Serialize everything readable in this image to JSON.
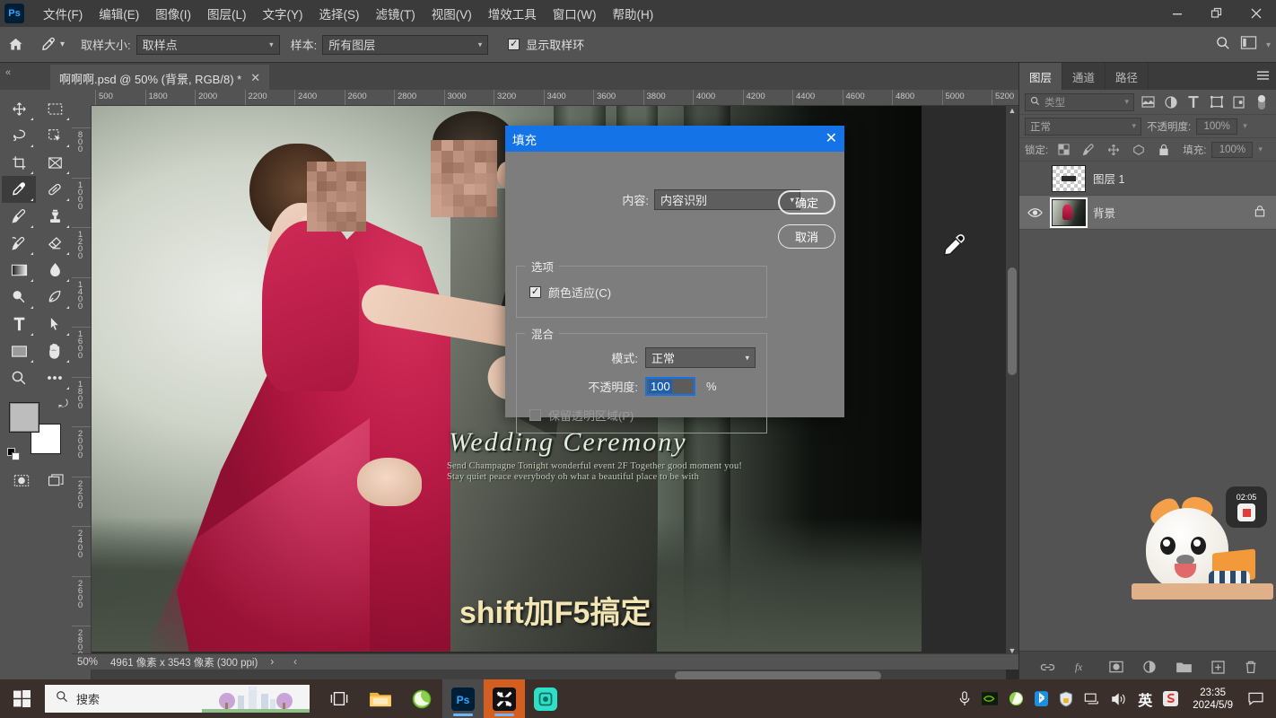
{
  "app": {
    "logo": "Ps",
    "menus": [
      {
        "label": "文件(F)"
      },
      {
        "label": "编辑(E)"
      },
      {
        "label": "图像(I)"
      },
      {
        "label": "图层(L)"
      },
      {
        "label": "文字(Y)"
      },
      {
        "label": "选择(S)"
      },
      {
        "label": "滤镜(T)"
      },
      {
        "label": "视图(V)"
      },
      {
        "label": "增效工具"
      },
      {
        "label": "窗口(W)"
      },
      {
        "label": "帮助(H)"
      }
    ],
    "window_controls": {
      "minimize": "—",
      "maximize": "❐",
      "close": "✕"
    }
  },
  "options_bar": {
    "home_icon": "home-icon",
    "tool_icon": "eyedropper-icon",
    "sample_size_label": "取样大小:",
    "sample_size_value": "取样点",
    "sample_label": "样本:",
    "sample_value": "所有图层",
    "show_ring_label": "显示取样环",
    "show_ring_checked": "✓",
    "search_icon": "search-icon",
    "workspace_icon": "workspace-icon"
  },
  "tab_bar": {
    "collapse": "«",
    "document_title": "啊啊啊.psd @ 50% (背景, RGB/8) *",
    "close": "✕",
    "expand": "»"
  },
  "toolbar": {
    "tools": [
      {
        "name": "move-tool",
        "selected": false
      },
      {
        "name": "marquee-tool",
        "selected": false
      },
      {
        "name": "lasso-tool",
        "selected": false
      },
      {
        "name": "quick-select-tool",
        "selected": false
      },
      {
        "name": "crop-tool",
        "selected": false
      },
      {
        "name": "frame-tool",
        "selected": false
      },
      {
        "name": "eyedropper-tool",
        "selected": true
      },
      {
        "name": "healing-brush-tool",
        "selected": false
      },
      {
        "name": "brush-tool",
        "selected": false
      },
      {
        "name": "clone-stamp-tool",
        "selected": false
      },
      {
        "name": "history-brush-tool",
        "selected": false
      },
      {
        "name": "eraser-tool",
        "selected": false
      },
      {
        "name": "gradient-tool",
        "selected": false
      },
      {
        "name": "blur-tool",
        "selected": false
      },
      {
        "name": "dodge-tool",
        "selected": false
      },
      {
        "name": "pen-tool",
        "selected": false
      },
      {
        "name": "type-tool",
        "selected": false
      },
      {
        "name": "path-selection-tool",
        "selected": false
      },
      {
        "name": "rectangle-tool",
        "selected": false
      },
      {
        "name": "hand-tool",
        "selected": false
      },
      {
        "name": "zoom-tool",
        "selected": false
      },
      {
        "name": "edit-toolbar-tool",
        "selected": false
      }
    ],
    "foreground_color": "#bdbdbd",
    "background_color": "#ffffff"
  },
  "canvas": {
    "ruler_h_ticks": [
      "500",
      "1800",
      "2000",
      "2200",
      "2400",
      "2600",
      "2800",
      "3000",
      "3200",
      "3400",
      "3600",
      "3800",
      "4000",
      "4200",
      "4400",
      "4600",
      "4800",
      "5000",
      "5200"
    ],
    "ruler_v_ticks": [
      "800",
      "1000",
      "1200",
      "1400",
      "1600",
      "1800",
      "2000",
      "2200",
      "2400",
      "2600",
      "2800"
    ],
    "artwork": {
      "title_text": "Wedding  Ceremony",
      "sub_text": "Send Champagne Tonight wonderful event 2F Together good moment you! Stay quiet peace everybody oh what a beautiful place to be with",
      "overlay_text": "shift加F5搞定",
      "cursor": "eyedropper-cursor"
    },
    "status": {
      "zoom": "50%",
      "dimensions": "4961 像素 x 3543 像素 (300 ppi)",
      "arrow": "›",
      "collapse": "‹"
    }
  },
  "right_panel": {
    "tabs": [
      {
        "label": "图层",
        "active": true
      },
      {
        "label": "通道",
        "active": false
      },
      {
        "label": "路径",
        "active": false
      }
    ],
    "menu_icon": "panel-menu-icon",
    "filter": {
      "search_icon": "search-icon",
      "type_label": "类型",
      "icons": [
        "image-filter-icon",
        "adjustment-filter-icon",
        "type-filter-icon",
        "shape-filter-icon",
        "smart-object-filter-icon"
      ],
      "toggle": "filter-toggle"
    },
    "blend": {
      "mode_label": "正常",
      "opacity_label": "不透明度:",
      "opacity_value": "100%"
    },
    "lock": {
      "label": "锁定:",
      "icons": [
        "lock-transparent-icon",
        "lock-image-icon",
        "lock-position-icon",
        "lock-artboard-icon",
        "lock-all-icon"
      ],
      "fill_label": "填充:",
      "fill_value": "100%"
    },
    "layers": [
      {
        "name": "图层 1",
        "visible": false,
        "locked": false,
        "selected": false,
        "thumb": "transparent"
      },
      {
        "name": "背景",
        "visible": true,
        "locked": true,
        "selected": true,
        "thumb": "photo"
      }
    ],
    "bottom_icons": [
      "link-layers-icon",
      "layer-style-fx-icon",
      "layer-mask-icon",
      "adjustment-layer-icon",
      "new-group-icon",
      "new-layer-icon",
      "delete-layer-icon"
    ]
  },
  "dialog": {
    "title": "填充",
    "close": "✕",
    "content_label": "内容:",
    "content_value": "内容识别",
    "ok_label": "确定",
    "cancel_label": "取消",
    "options_legend": "选项",
    "color_adapt_label": "颜色适应(C)",
    "color_adapt_checked": "✓",
    "blend_legend": "混合",
    "mode_label": "模式:",
    "mode_value": "正常",
    "opacity_label": "不透明度:",
    "opacity_value": "100",
    "percent": "%",
    "preserve_label": "保留透明区域(P)"
  },
  "overlay": {
    "recorder_time": "02:05",
    "recorder_button": "stop-record-button",
    "ime_badge": "英"
  },
  "taskbar": {
    "start_icon": "windows-start-icon",
    "search_placeholder": "搜索",
    "search_icon": "search-icon",
    "apps": [
      {
        "name": "task-view-icon",
        "active": false
      },
      {
        "name": "file-explorer-icon",
        "active": false
      },
      {
        "name": "browser-icon",
        "active": false
      },
      {
        "name": "photoshop-icon",
        "active": true,
        "label": "Ps"
      },
      {
        "name": "capcut-icon",
        "active": true
      },
      {
        "name": "screen-recorder-icon",
        "active": false
      }
    ],
    "tray": [
      "microphone-icon",
      "nvidia-icon",
      "browser-tray-icon",
      "bluetooth-icon",
      "security-icon",
      "network-icon",
      "volume-icon"
    ],
    "ime_label": "英",
    "sogou_icon": "sogou-input-icon",
    "time": "23:35",
    "date": "2024/5/9",
    "notification_icon": "notification-icon"
  }
}
